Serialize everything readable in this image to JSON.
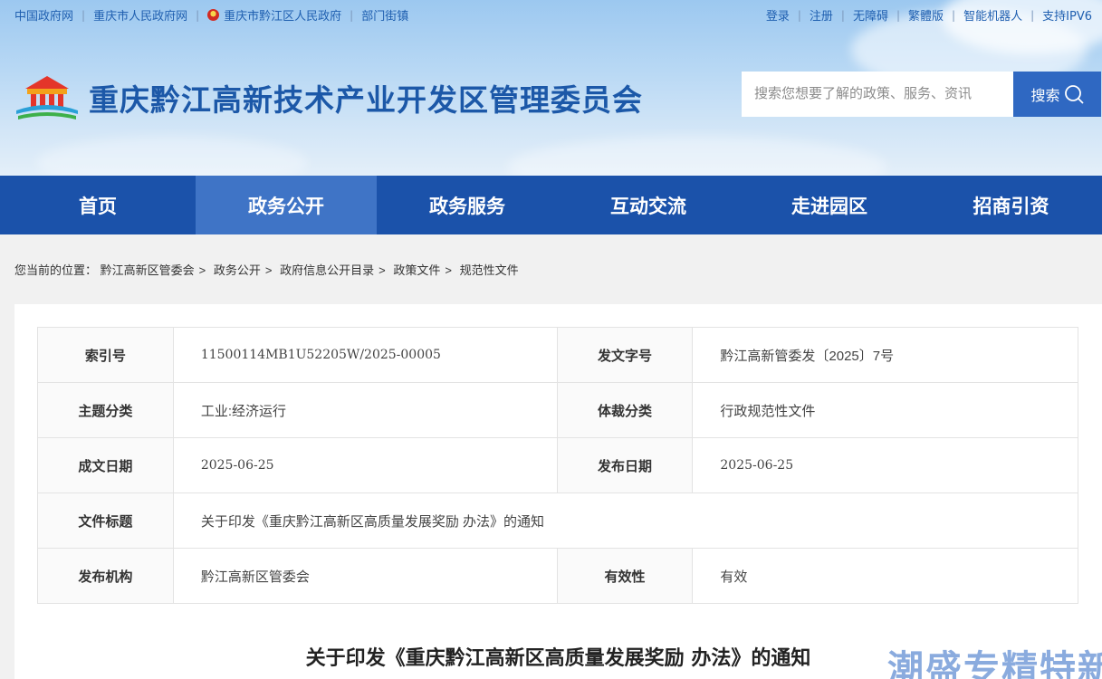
{
  "topbar": {
    "left_links": [
      "中国政府网",
      "重庆市人民政府网",
      "重庆市黔江区人民政府",
      "部门街镇"
    ],
    "right_links": [
      "登录",
      "注册",
      "无障碍",
      "繁體版",
      "智能机器人",
      "支持IPV6"
    ]
  },
  "header": {
    "site_title": "重庆黔江高新技术产业开发区管理委员会",
    "search_placeholder": "搜索您想要了解的政策、服务、资讯",
    "search_button": "搜索"
  },
  "nav": {
    "items": [
      "首页",
      "政务公开",
      "政务服务",
      "互动交流",
      "走进园区",
      "招商引资"
    ],
    "active_index": 1
  },
  "breadcrumb": {
    "prefix": "您当前的位置：",
    "items": [
      "黔江高新区管委会",
      "政务公开",
      "政府信息公开目录",
      "政策文件",
      "规范性文件"
    ]
  },
  "meta": {
    "index_no_label": "索引号",
    "index_no": "11500114MB1U52205W/2025-00005",
    "doc_no_label": "发文字号",
    "doc_no": "黔江高新管委发〔2025〕7号",
    "topic_label": "主题分类",
    "topic": "工业:经济运行",
    "genre_label": "体裁分类",
    "genre": "行政规范性文件",
    "written_date_label": "成文日期",
    "written_date": "2025-06-25",
    "publish_date_label": "发布日期",
    "publish_date": "2025-06-25",
    "title_label": "文件标题",
    "title": "关于印发《重庆黔江高新区高质量发展奖励 办法》的通知",
    "issuer_label": "发布机构",
    "issuer": "黔江高新区管委会",
    "validity_label": "有效性",
    "validity": "有效"
  },
  "document": {
    "title": "关于印发《重庆黔江高新区高质量发展奖励 办法》的通知"
  },
  "watermark": "潮盛专精特新",
  "colors": {
    "brand_blue": "#1b52aa",
    "nav_active": "#3f74c6",
    "title_blue": "#1c58a8",
    "search_button": "#2f68c2"
  }
}
